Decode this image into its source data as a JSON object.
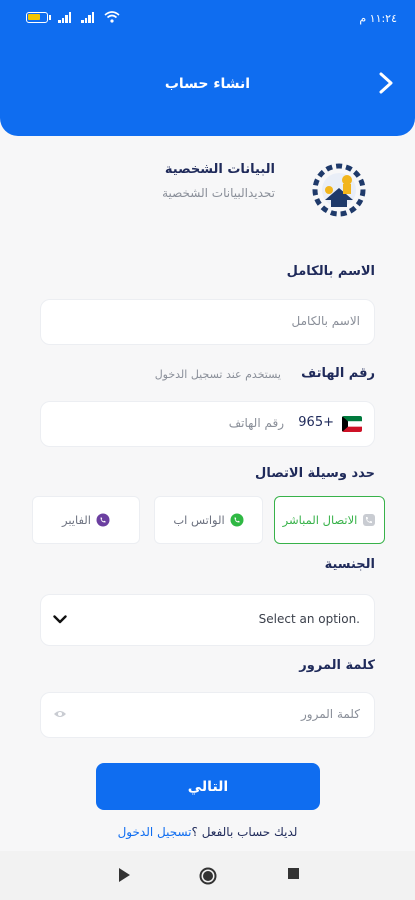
{
  "status_bar": {
    "time": "١١:٢٤ م",
    "icons": [
      "battery-icon",
      "signal-icon",
      "signal-icon",
      "wifi-icon"
    ]
  },
  "header": {
    "title": "انشاء حساب",
    "back_icon": "chevron-right-icon"
  },
  "profile": {
    "title": "البيانات الشخصية",
    "subtitle": "تحديدالبيانات الشخصية"
  },
  "full_name": {
    "label": "الاسم بالكامل",
    "placeholder": "الاسم بالكامل"
  },
  "phone": {
    "label": "رقم الهاتف",
    "hint": "يستخدم عند تسجيل الدخول",
    "country_code": "965+",
    "placeholder": "رقم الهاتف"
  },
  "contact_method": {
    "label": "حدد وسيلة الاتصال",
    "options": [
      {
        "label": "الاتصال المباشر",
        "icon": "phone-icon",
        "selected": true
      },
      {
        "label": "الواتس اب",
        "icon": "whatsapp-icon",
        "selected": false
      },
      {
        "label": "الفايبر",
        "icon": "viber-icon",
        "selected": false
      }
    ]
  },
  "nationality": {
    "label": "الجنسية",
    "placeholder": "Select an option."
  },
  "password": {
    "label": "كلمة المرور",
    "placeholder": "كلمة المرور"
  },
  "next_button": "التالي",
  "login_prompt": {
    "text": "لديك حساب بالفعل ؟",
    "link": "تسجيل الدخول"
  },
  "colors": {
    "primary": "#0f6df0",
    "accent_green": "#38b24a",
    "text_dark": "#1f2a5a"
  }
}
